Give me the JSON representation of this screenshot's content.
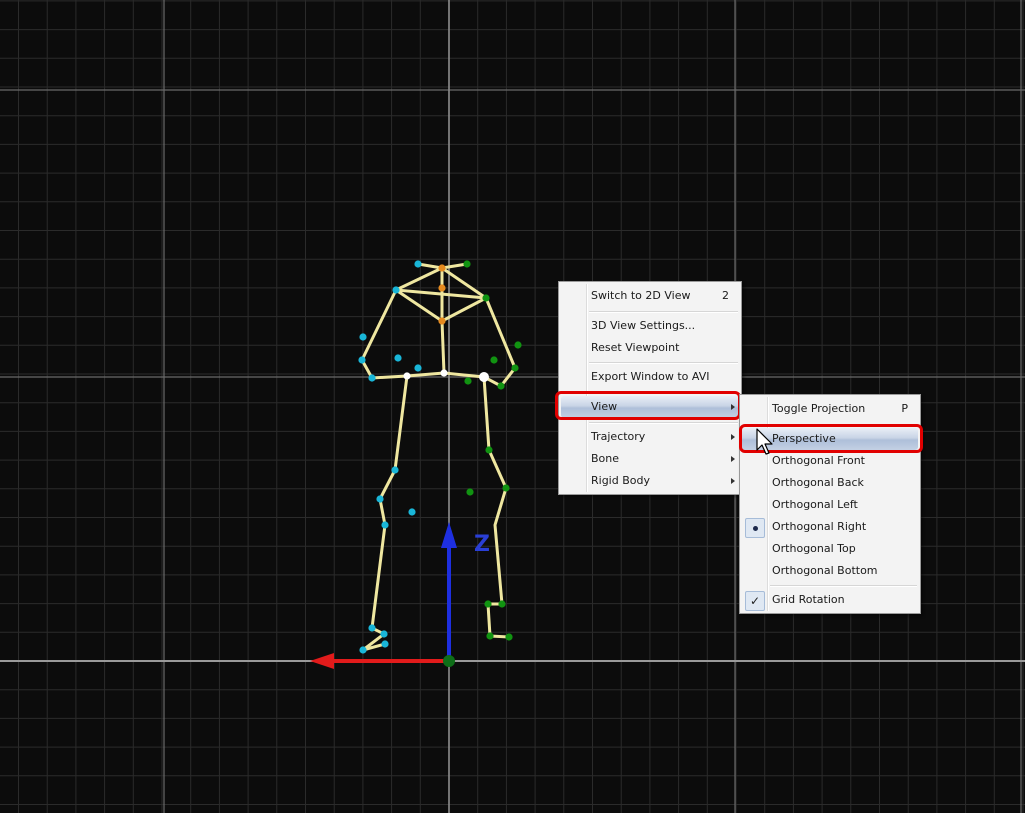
{
  "scene": {
    "axis_label": "Z",
    "colors": {
      "background": "#0c0c0c",
      "grid": "#3a3a3a",
      "bone": "#efe7a0",
      "marker_left": "#19b6d8",
      "marker_right": "#119311",
      "marker_head": "#e58a1f",
      "axis_z": "#1e2fe0",
      "axis_x": "#e21b1b",
      "highlight_frame": "#e10000"
    }
  },
  "main_menu": {
    "items": [
      {
        "id": "switch-2d",
        "label": "Switch to 2D View",
        "shortcut": "2"
      },
      {
        "id": "3d-settings",
        "label": "3D View Settings..."
      },
      {
        "id": "reset-viewpoint",
        "label": "Reset Viewpoint"
      },
      {
        "id": "export-avi",
        "label": "Export Window to AVI"
      },
      {
        "id": "view",
        "label": "View",
        "submenu": true,
        "highlighted": true
      },
      {
        "id": "trajectory",
        "label": "Trajectory",
        "submenu": true
      },
      {
        "id": "bone",
        "label": "Bone",
        "submenu": true
      },
      {
        "id": "rigid-body",
        "label": "Rigid Body",
        "submenu": true
      }
    ]
  },
  "view_submenu": {
    "items": [
      {
        "id": "toggle-projection",
        "label": "Toggle Projection",
        "shortcut": "P"
      },
      {
        "id": "perspective",
        "label": "Perspective",
        "highlighted": true
      },
      {
        "id": "ortho-front",
        "label": "Orthogonal Front"
      },
      {
        "id": "ortho-back",
        "label": "Orthogonal Back"
      },
      {
        "id": "ortho-left",
        "label": "Orthogonal Left"
      },
      {
        "id": "ortho-right",
        "label": "Orthogonal Right",
        "state": "selected"
      },
      {
        "id": "ortho-top",
        "label": "Orthogonal Top"
      },
      {
        "id": "ortho-bottom",
        "label": "Orthogonal Bottom"
      },
      {
        "id": "grid-rotation",
        "label": "Grid Rotation",
        "state": "checked",
        "check_glyph": "✓"
      }
    ]
  }
}
